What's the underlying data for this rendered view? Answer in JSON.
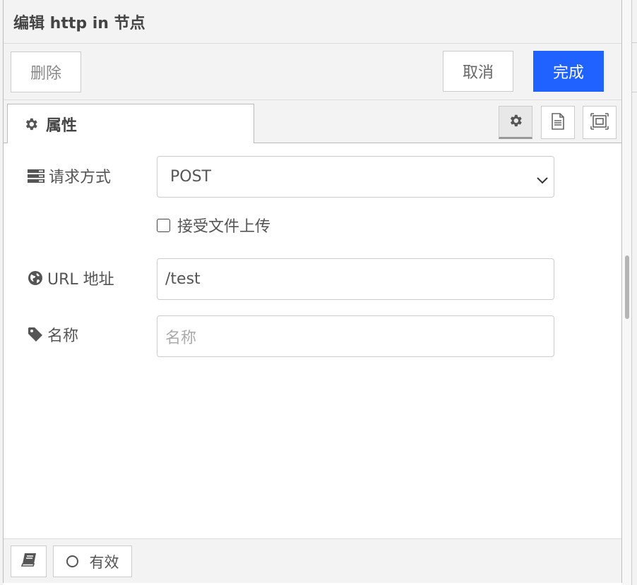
{
  "dialog": {
    "title": "编辑 http in 节点"
  },
  "toolbar": {
    "delete_label": "删除",
    "cancel_label": "取消",
    "done_label": "完成"
  },
  "tabs": {
    "properties_label": "属性",
    "icons": [
      "gear-icon",
      "document-icon",
      "frame-icon"
    ]
  },
  "form": {
    "method": {
      "label": "请求方式",
      "value": "POST"
    },
    "upload": {
      "label": "接受文件上传",
      "checked": false
    },
    "url": {
      "label": "URL 地址",
      "value": "/test"
    },
    "name": {
      "label": "名称",
      "placeholder": "名称",
      "value": ""
    }
  },
  "footer": {
    "enabled_label": "有效"
  },
  "colors": {
    "primary": "#1f62ff",
    "panel_bg": "#f3f3f3",
    "border": "#cccccc"
  }
}
